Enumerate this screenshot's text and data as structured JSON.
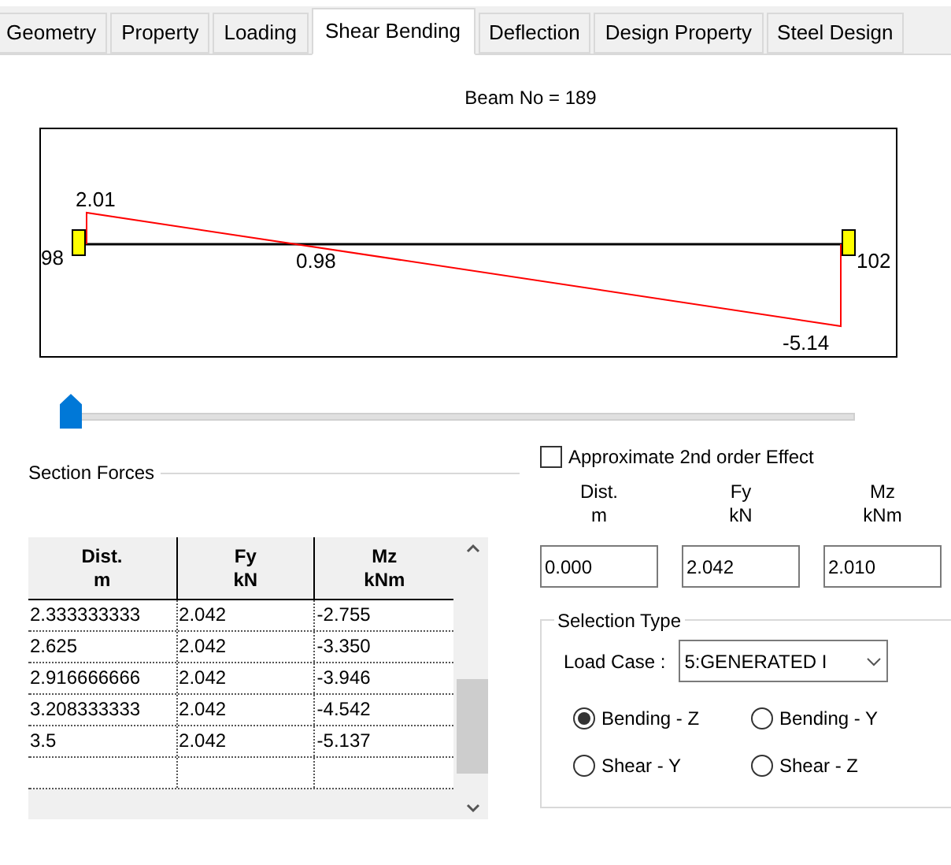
{
  "tabs": [
    {
      "label": "Geometry",
      "selected": false
    },
    {
      "label": "Property",
      "selected": false
    },
    {
      "label": "Loading",
      "selected": false
    },
    {
      "label": "Shear Bending",
      "selected": true
    },
    {
      "label": "Deflection",
      "selected": false
    },
    {
      "label": "Design Property",
      "selected": false
    },
    {
      "label": "Steel Design",
      "selected": false
    }
  ],
  "beam_title": "Beam No = 189",
  "diagram": {
    "start_node": "98",
    "end_node": "102",
    "max_label": "2.01",
    "mid_label": "0.98",
    "min_label": "-5.14"
  },
  "position_slider": {
    "level": 0
  },
  "section_forces": {
    "title": "Section Forces",
    "columns": [
      {
        "name": "Dist.",
        "unit": "m"
      },
      {
        "name": "Fy",
        "unit": "kN"
      },
      {
        "name": "Mz",
        "unit": "kNm"
      }
    ],
    "rows": [
      [
        "2.333333333",
        "2.042",
        "-2.755"
      ],
      [
        "2.625",
        "2.042",
        "-3.350"
      ],
      [
        "2.916666666",
        "2.042",
        "-3.946"
      ],
      [
        "3.208333333",
        "2.042",
        "-4.542"
      ],
      [
        "3.5",
        "2.042",
        "-5.137"
      ]
    ]
  },
  "second_order": {
    "label": "Approximate 2nd order Effect",
    "checked": false
  },
  "readouts": [
    {
      "name": "Dist.",
      "unit": "m",
      "value": "0.000"
    },
    {
      "name": "Fy",
      "unit": "kN",
      "value": "2.042"
    },
    {
      "name": "Mz",
      "unit": "kNm",
      "value": "2.010"
    }
  ],
  "selection_type": {
    "title": "Selection Type",
    "load_case_label": "Load Case :",
    "load_case": "5:GENERATED I",
    "options": [
      {
        "label": "Bending - Z",
        "selected": true
      },
      {
        "label": "Bending - Y",
        "selected": false
      },
      {
        "label": "Shear - Y",
        "selected": false
      },
      {
        "label": "Shear - Z",
        "selected": false
      }
    ]
  }
}
